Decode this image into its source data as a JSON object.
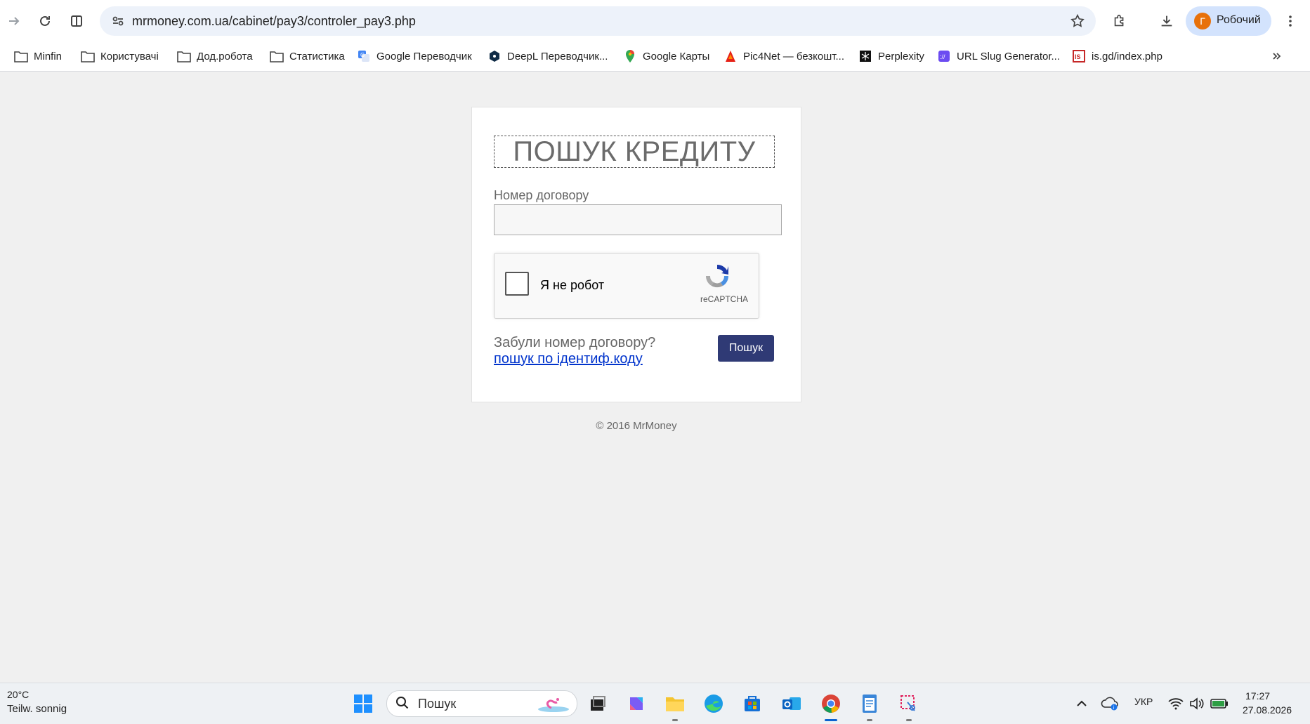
{
  "browser": {
    "url": "mrmoney.com.ua/cabinet/pay3/controler_pay3.php",
    "profile": {
      "initial": "Г",
      "label": "Робочий"
    },
    "bookmarks": [
      {
        "label": "Minfin",
        "icon": "folder-icon"
      },
      {
        "label": "Користувачі",
        "icon": "folder-icon"
      },
      {
        "label": "Дод.робота",
        "icon": "folder-icon"
      },
      {
        "label": "Статистика",
        "icon": "folder-icon"
      },
      {
        "label": "Google Переводчик",
        "icon": "google-translate-icon"
      },
      {
        "label": "DeepL Переводчик...",
        "icon": "deepl-icon"
      },
      {
        "label": "Google Карты",
        "icon": "google-maps-icon"
      },
      {
        "label": "Pic4Net — безкошт...",
        "icon": "pic4net-icon"
      },
      {
        "label": "Perplexity",
        "icon": "perplexity-icon"
      },
      {
        "label": "URL Slug Generator...",
        "icon": "url-slug-icon"
      },
      {
        "label": "is.gd/index.php",
        "icon": "isgd-icon"
      }
    ]
  },
  "page": {
    "title": "ПОШУК КРЕДИТУ",
    "contract_label": "Номер договору",
    "contract_value": "",
    "recaptcha": {
      "label": "Я не робот",
      "brand": "reCAPTCHA"
    },
    "forgot_text": "Забули номер договору?",
    "id_link": "пошук по ідентиф.коду",
    "search_button": "Пошук",
    "footer": "© 2016 MrMoney"
  },
  "taskbar": {
    "weather_temp": "20°C",
    "weather_desc": "Teilw. sonnig",
    "search_placeholder": "Пошук",
    "language": "УКР",
    "time": "17:27",
    "date": "27.08.2026"
  },
  "colors": {
    "button": "#2f3a75",
    "link": "#0033cc",
    "profile_avatar": "#e8710a",
    "omnibox": "#edf2fa"
  }
}
